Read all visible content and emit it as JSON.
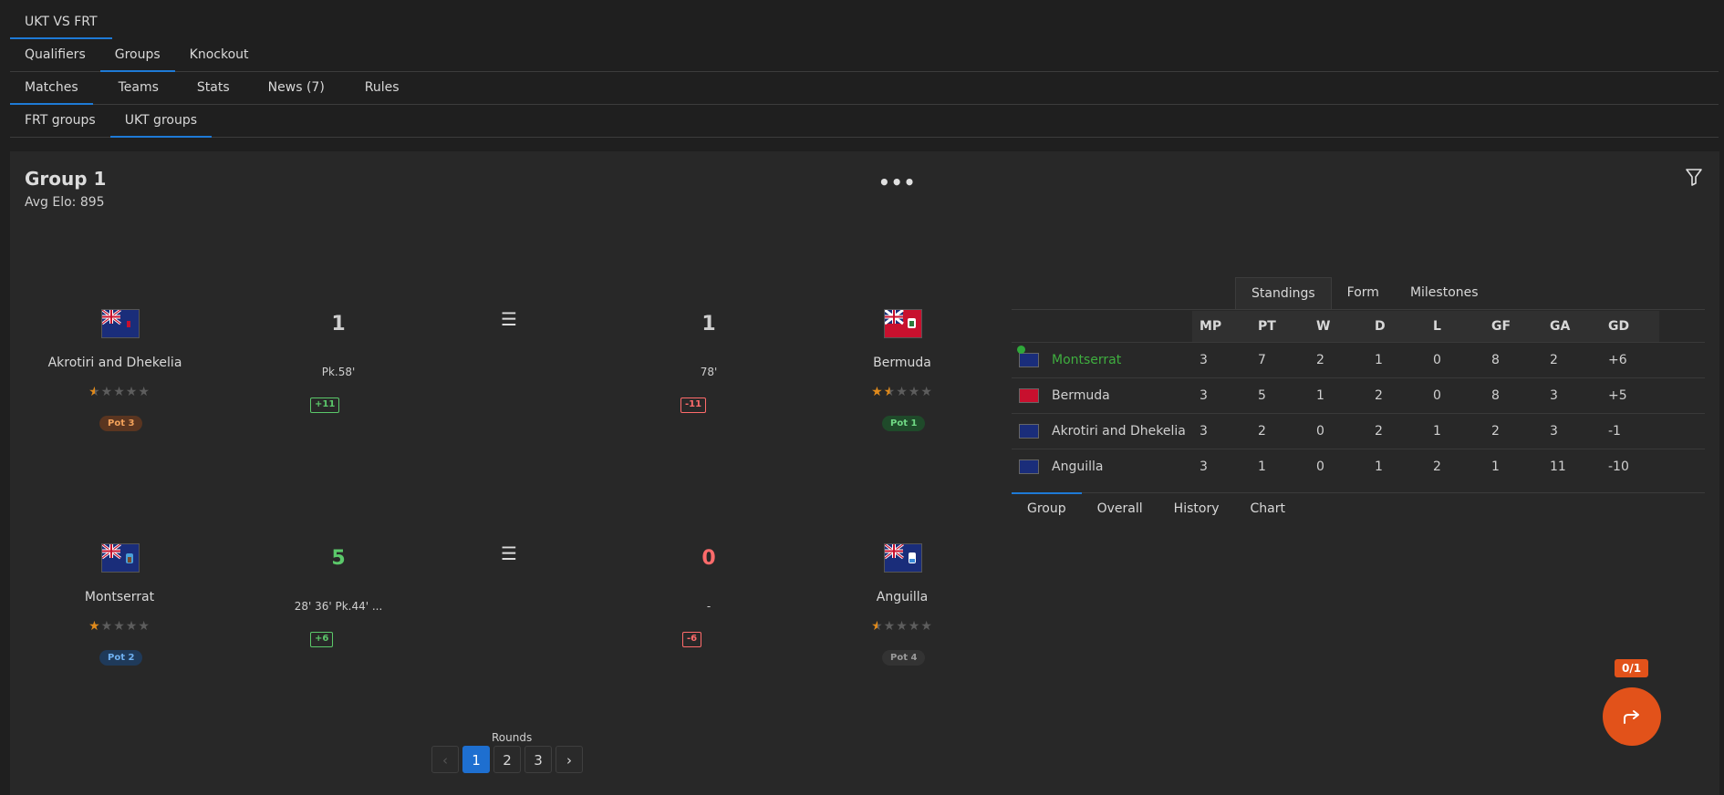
{
  "nav": {
    "title_tab": "UKT VS FRT",
    "stage_tabs": [
      "Qualifiers",
      "Groups",
      "Knockout"
    ],
    "section_tabs": [
      "Matches",
      "Teams",
      "Stats",
      "News (7)",
      "Rules"
    ],
    "group_tabs": [
      "FRT groups",
      "UKT groups"
    ]
  },
  "group": {
    "title": "Group 1",
    "avg_elo": "Avg Elo: 895"
  },
  "matches": [
    {
      "home": {
        "name": "Akrotiri and Dhekelia",
        "stars": 0.5,
        "pot": "Pot 3",
        "score": "1",
        "detail": "Pk.58'",
        "elo": "+11"
      },
      "away": {
        "name": "Bermuda",
        "stars": 1.5,
        "pot": "Pot 1",
        "score": "1",
        "detail": "78'",
        "elo": "-11"
      }
    },
    {
      "home": {
        "name": "Montserrat",
        "stars": 1,
        "pot": "Pot 2",
        "score": "5",
        "detail": "28' 36' Pk.44' ...",
        "elo": "+6"
      },
      "away": {
        "name": "Anguilla",
        "stars": 0.5,
        "pot": "Pot 4",
        "score": "0",
        "detail": "-",
        "elo": "-6"
      }
    }
  ],
  "pager": {
    "label": "Rounds",
    "pages": [
      "1",
      "2",
      "3"
    ],
    "current": "1"
  },
  "standings": {
    "tabs": [
      "Standings",
      "Form",
      "Milestones"
    ],
    "columns": [
      "MP",
      "PT",
      "W",
      "D",
      "L",
      "GF",
      "GA",
      "GD"
    ],
    "rows": [
      {
        "team": "Montserrat",
        "mp": "3",
        "pt": "7",
        "w": "2",
        "d": "1",
        "l": "0",
        "gf": "8",
        "ga": "2",
        "gd": "+6"
      },
      {
        "team": "Bermuda",
        "mp": "3",
        "pt": "5",
        "w": "1",
        "d": "2",
        "l": "0",
        "gf": "8",
        "ga": "3",
        "gd": "+5"
      },
      {
        "team": "Akrotiri and Dhekelia",
        "mp": "3",
        "pt": "2",
        "w": "0",
        "d": "2",
        "l": "1",
        "gf": "2",
        "ga": "3",
        "gd": "-1"
      },
      {
        "team": "Anguilla",
        "mp": "3",
        "pt": "1",
        "w": "0",
        "d": "1",
        "l": "2",
        "gf": "1",
        "ga": "11",
        "gd": "-10"
      }
    ],
    "bottom_tabs": [
      "Group",
      "Overall",
      "History",
      "Chart"
    ]
  },
  "share": {
    "badge": "0/1"
  },
  "colors": {
    "accent": "#1e7ad6",
    "positive": "#5bc86a",
    "negative": "#ff6b6b",
    "fab": "#e2521a",
    "star": "#e08a1c"
  }
}
